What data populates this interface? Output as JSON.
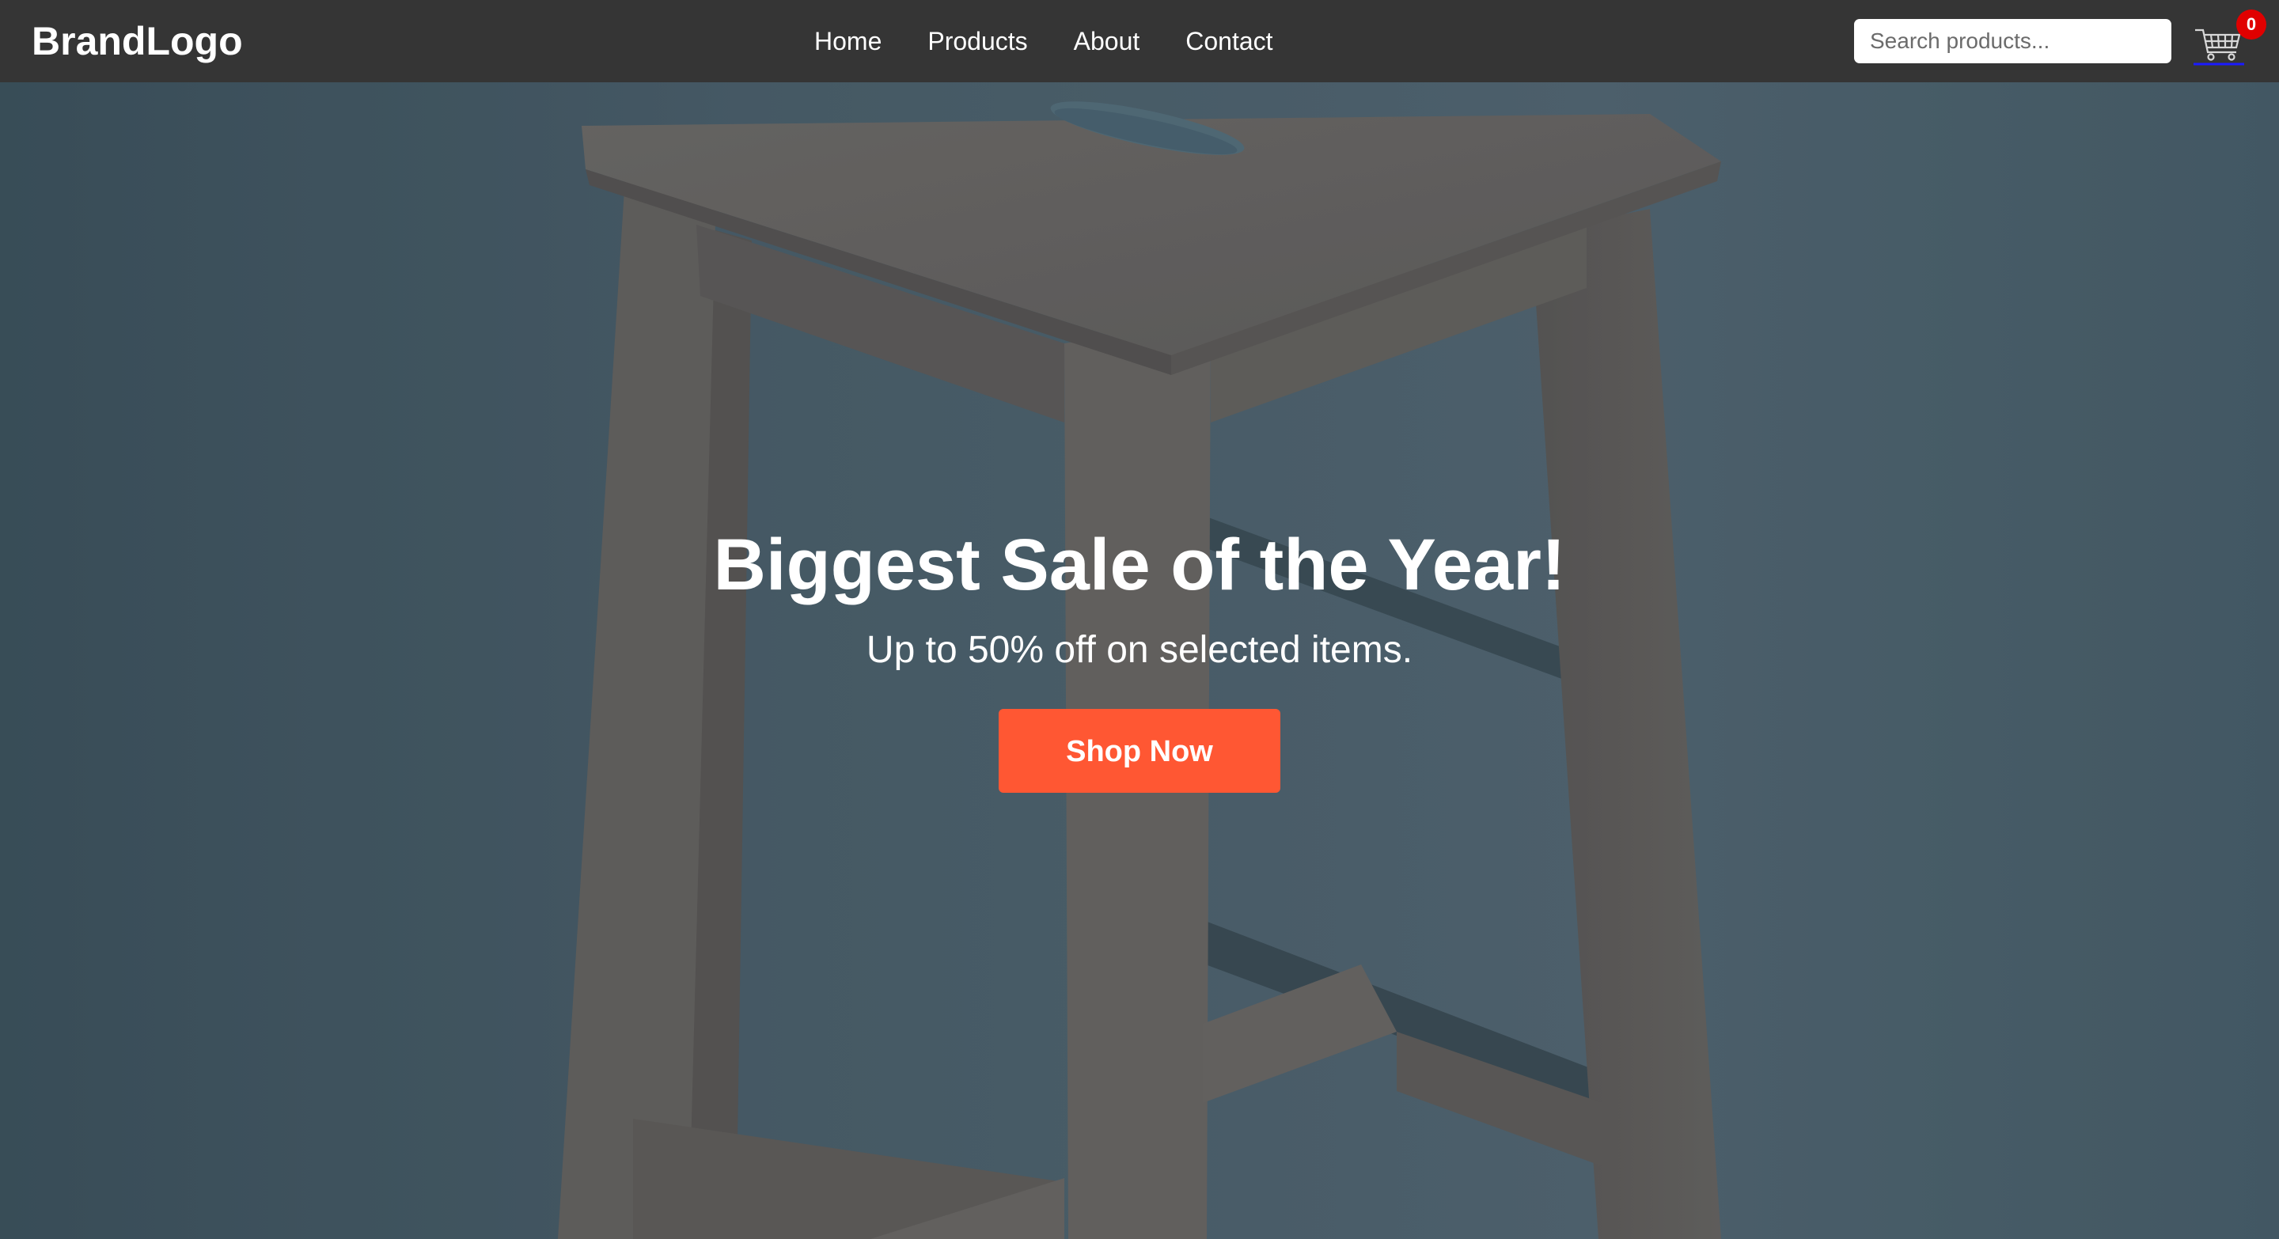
{
  "navbar": {
    "brand": "BrandLogo",
    "links": [
      {
        "label": "Home"
      },
      {
        "label": "Products"
      },
      {
        "label": "About"
      },
      {
        "label": "Contact"
      }
    ],
    "search": {
      "placeholder": "Search products...",
      "value": ""
    },
    "cart": {
      "icon": "shopping-cart-icon",
      "count": "0"
    }
  },
  "hero": {
    "background": "wooden-stool-photo",
    "title": "Biggest Sale of the Year!",
    "subtitle": "Up to 50% off on selected items.",
    "cta_label": "Shop Now"
  },
  "colors": {
    "navbar_bg": "#353535",
    "cta_bg": "#ff5733",
    "badge_bg": "#e00000",
    "hero_bg": "#4c6270"
  }
}
